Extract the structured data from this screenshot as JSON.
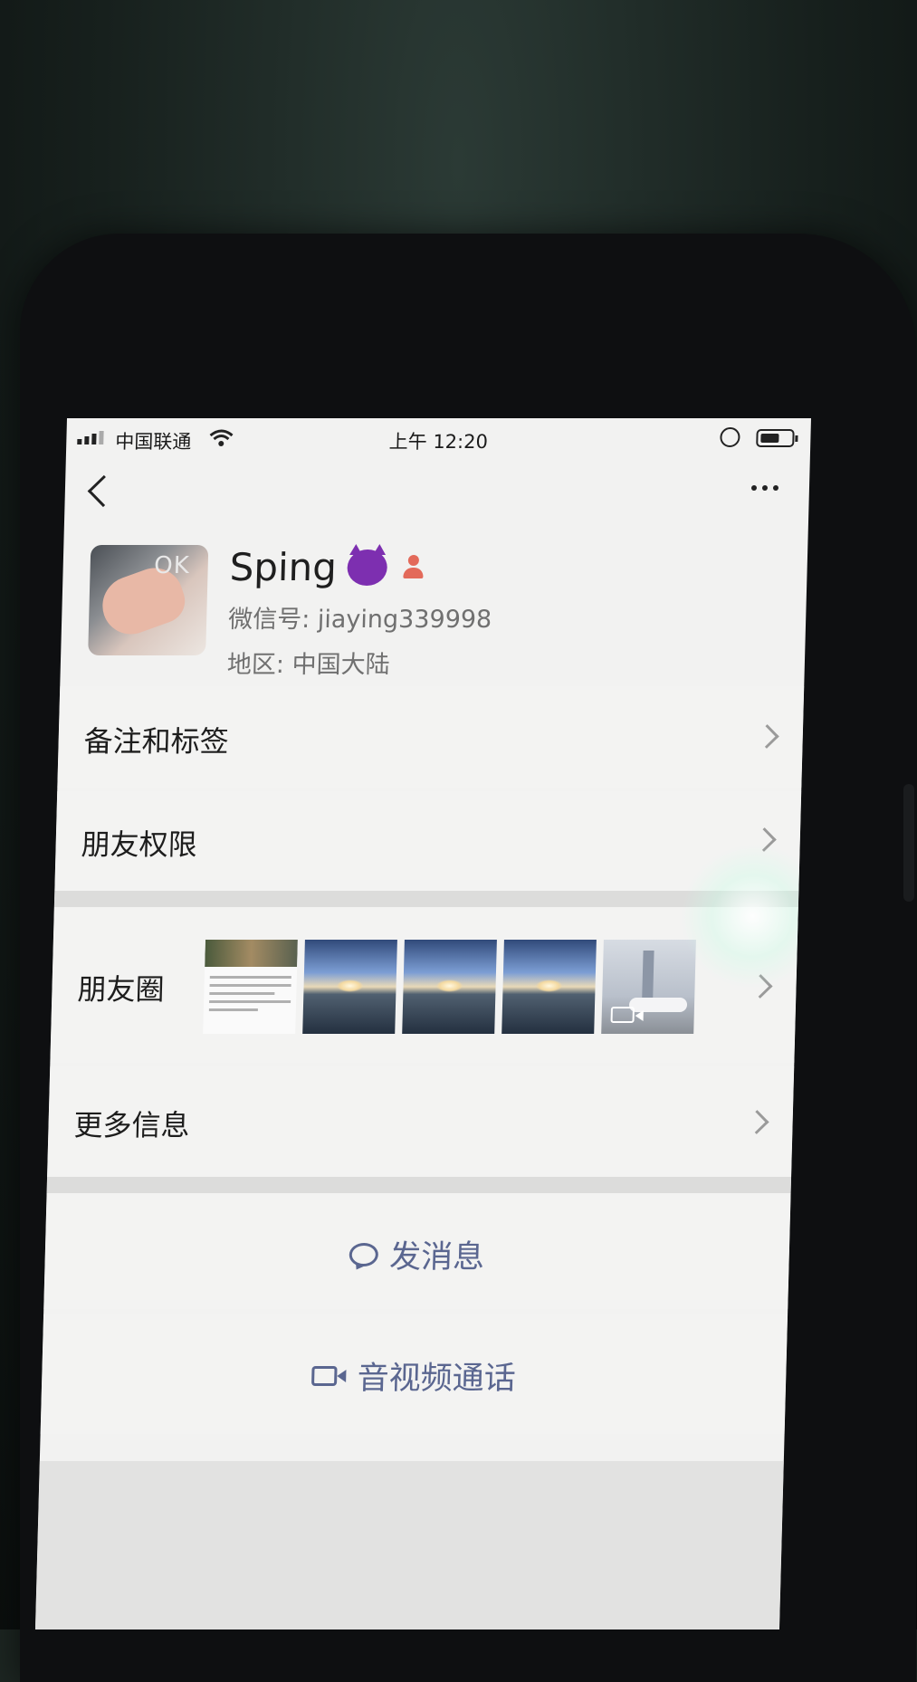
{
  "status_bar": {
    "carrier": "中国联通",
    "time": "上午 12:20"
  },
  "profile": {
    "name": "Sping",
    "avatar_text": "OK",
    "wechat_id_line": "微信号: jiaying339998",
    "region_line": "地区: 中国大陆"
  },
  "menu": {
    "remarks_tags": "备注和标签",
    "friend_permissions": "朋友权限",
    "moments": "朋友圈",
    "more_info": "更多信息"
  },
  "actions": {
    "send_message": "发消息",
    "video_call": "音视频通话"
  },
  "icons": [
    "back-icon",
    "more-icon",
    "devil-icon",
    "female-icon",
    "chevron-right-icon",
    "video-icon",
    "chat-icon",
    "camera-icon"
  ],
  "colors": {
    "action_text": "#5a6690",
    "background": "#f3f3f2",
    "separator": "#dcdcdb",
    "female_badge": "#e36a5a"
  }
}
